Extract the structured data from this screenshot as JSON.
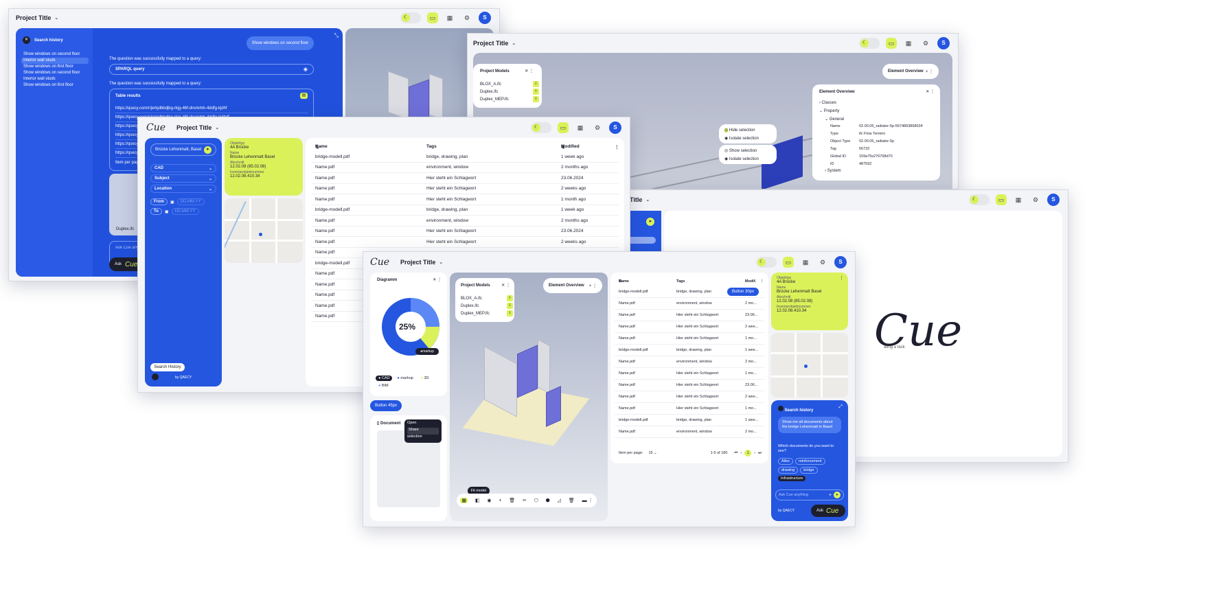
{
  "common": {
    "project_title": "Project Title",
    "avatar": "S",
    "logo": "Cue",
    "moon_icon": "moon-icon",
    "folder_icon": "folder-icon",
    "grid_icon": "grid-icon",
    "gear_icon": "gear-icon"
  },
  "w1": {
    "search_history": "Search history",
    "history_items": [
      "Show windows on second floor",
      "Interior wall studs",
      "Show windows on first floor",
      "Show windows on second floor",
      "Interior wall studs",
      "Show windows on first floor"
    ],
    "bubble": "Show windows on second floor",
    "mapped1": "The question was successfully mapped to a query:",
    "sparql": "SPARQL query",
    "mapped2": "The question was successfully mapped to a query:",
    "table_results": "Table results",
    "links": [
      "https://qsecy.com/r/jerkjdbbdjbg-rkjg-46f-dnv/ehrk-4ddfg-kjdhf",
      "https://qsecy.com/r/jerkjdbbdjbg-rkjg-46f-dnv/ehrk-4ddfg-kjdhdf",
      "https://qsecy.co",
      "https://qsecy.co",
      "https://qsecy.co",
      "https://qsecy.co"
    ],
    "items_per_page": "Item per page:",
    "model_label": "Duplex.ifc",
    "ask_placeholder": "Ask Cue anything",
    "ask": "Ask"
  },
  "w2": {
    "project_models": "Project Models",
    "models": [
      "BLOX_A.ifc",
      "Duplex.ifc",
      "Duplex_MEP.ifc"
    ],
    "element_overview": "Element Overview",
    "element_overview_panel": "Element Overview",
    "tree": {
      "classes": "Classes",
      "property": "Property",
      "general": "General",
      "system": "System"
    },
    "props": [
      [
        "Name",
        "02.00.05_radiator-5p-5674863868634"
      ],
      [
        "Type",
        "ifc Flow Termini"
      ],
      [
        "Object Type",
        "02.00.05_radiator-5p"
      ],
      [
        "Tag",
        "56732"
      ],
      [
        "Global ID",
        "159a79s276768d70"
      ],
      [
        "ID",
        "487592"
      ]
    ],
    "ctx1": [
      "Hide selection",
      "Isolate selection"
    ],
    "ctx2": [
      "Show selection",
      "Isolate selection"
    ]
  },
  "w3": {
    "search_value": "Brücke Lehenmatt, Basel",
    "filters": [
      "CAD",
      "Subject",
      "Location"
    ],
    "from": "From",
    "to": "To",
    "date_ph": "DD.MM.YY",
    "card": {
      "objekttyp_l": "Objekttyp",
      "objekttyp": "4A Brücke",
      "name_l": "Name",
      "name": "Brücke Lehenmatt Basel",
      "abschnitt_l": "Abschnitt",
      "abschnitt": "12.02.08 (85.02.08)",
      "inv_l": "Inventarobjektnummer",
      "inv": "12.02.08.410.34"
    },
    "search_history_btn": "Search History",
    "by": "by QAECY",
    "cols": [
      "Name",
      "Tags",
      "Modified"
    ],
    "rows": [
      [
        "bridge-modell.pdf",
        "bridge, drawing, plan",
        "1 week ago"
      ],
      [
        "Name.pdf",
        "environment, window",
        "2 months ago"
      ],
      [
        "Name.pdf",
        "Hier steht ein Schlagwort",
        "23.06.2024"
      ],
      [
        "Name.pdf",
        "Hier steht ein Schlagwort",
        "2 weeks ago"
      ],
      [
        "Name.pdf",
        "Hier steht ein Schlagwort",
        "1 month ago"
      ],
      [
        "bridge-modell.pdf",
        "bridge, drawing, plan",
        "1 week ago"
      ],
      [
        "Name.pdf",
        "environment, window",
        "2 months ago"
      ],
      [
        "Name.pdf",
        "Hier steht ein Schlagwort",
        "23.06.2024"
      ],
      [
        "Name.pdf",
        "Hier steht ein Schlagwort",
        "2 weeks ago"
      ],
      [
        "Name.pdf",
        "",
        ""
      ],
      [
        "bridge-modell.pdf",
        "",
        ""
      ],
      [
        "Name.pdf",
        "",
        ""
      ],
      [
        "Name.pdf",
        "",
        ""
      ],
      [
        "Name.pdf",
        "",
        ""
      ],
      [
        "Name.pdf",
        "",
        ""
      ],
      [
        "Name.pdf",
        "",
        ""
      ]
    ]
  },
  "w4": {
    "logo": "Cue",
    "tagline": "ating a task"
  },
  "w5": {
    "diagram": "Diagramm",
    "pct": "25%",
    "markup_tag": "markup",
    "legend": [
      "CAD",
      "markup",
      "3D",
      "BIM"
    ],
    "button45": "Button 45px",
    "document": "Document",
    "menu": [
      "Open",
      "Share",
      "selection"
    ],
    "project_models": "Project Models",
    "models": [
      "BLOX_A.ifc",
      "Duplex.ifc",
      "Duplex_MEP.ifc"
    ],
    "element_overview": "Element Overview",
    "fit_model": "Fit model",
    "cols": [
      "Name",
      "Tags",
      "Modif."
    ],
    "button30": "Button 30px",
    "rows": [
      [
        "bridge-modell.pdf",
        "bridge, drawing, plan",
        ""
      ],
      [
        "Name.pdf",
        "environment, window",
        "2 mo..."
      ],
      [
        "Name.pdf",
        "Hier steht ein Schlagwort",
        "23.06..."
      ],
      [
        "Name.pdf",
        "Hier steht ein Schlagwort",
        "2 wee..."
      ],
      [
        "Name.pdf",
        "Hier steht ein Schlagwort",
        "1 mo..."
      ],
      [
        "bridge-modell.pdf",
        "bridge, drawing, plan",
        "1 wee..."
      ],
      [
        "Name.pdf",
        "environment, window",
        "2 mo..."
      ],
      [
        "Name.pdf",
        "Hier steht ein Schlagwort",
        "1 mo..."
      ],
      [
        "Name.pdf",
        "Hier steht ein Schlagwort",
        "23.06..."
      ],
      [
        "Name.pdf",
        "Hier steht ein Schlagwort",
        "2 wee..."
      ],
      [
        "Name.pdf",
        "Hier steht ein Schlagwort",
        "1 mo..."
      ],
      [
        "bridge-modell.pdf",
        "bridge, drawing, plan",
        "1 wee..."
      ],
      [
        "Name.pdf",
        "environment, window",
        "2 mo..."
      ]
    ],
    "items_per_page": "Item per page:",
    "ipp_value": "15",
    "range": "1-5 of 180",
    "page": "1",
    "card": {
      "objekttyp_l": "Objekttyp",
      "objekttyp": "4A Brücke",
      "name_l": "Name",
      "name": "Brücke Lehenmatt Basel",
      "abschnitt_l": "Abschnitt",
      "abschnitt": "12.02.08 (85.02.08)",
      "inv_l": "Inventarobjektnummer",
      "inv": "12.02.08.410.34"
    },
    "search_history": "Search history",
    "question": "Show me all documents about the bridge Lehenmatt in Basel",
    "which": "Which documents do you want to see?",
    "chips": [
      "Alles",
      "reinforcement",
      "drawing",
      "bridge",
      "Infrastructure"
    ],
    "ask_placeholder": "Ask Cue anything",
    "by": "by QAECY",
    "ask": "Ask"
  }
}
